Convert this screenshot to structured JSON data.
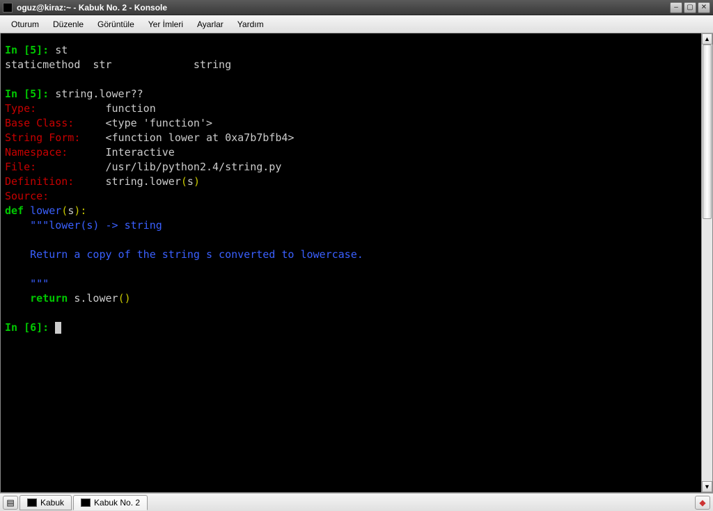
{
  "window": {
    "title": "oguz@kiraz:~ - Kabuk No. 2 - Konsole"
  },
  "menu": {
    "items": [
      "Oturum",
      "Düzenle",
      "Görüntüle",
      "Yer İmleri",
      "Ayarlar",
      "Yardım"
    ]
  },
  "terminal": {
    "line1_prompt": "In [5]: ",
    "line1_cmd": "st",
    "line2": "staticmethod  str             string",
    "line3_prompt": "In [5]: ",
    "line3_cmd": "string.lower??",
    "type_label": "Type:",
    "type_val": "           function",
    "base_label": "Base Class:",
    "base_val": "     <type 'function'>",
    "strform_label": "String Form:",
    "strform_val": "    <function lower at 0xa7b7bfb4>",
    "ns_label": "Namespace:",
    "ns_val": "      Interactive",
    "file_label": "File:",
    "file_val": "           /usr/lib/python2.4/string.py",
    "def_label": "Definition:",
    "def_pre": "     string.lower",
    "def_paren_open": "(",
    "def_arg": "s",
    "def_paren_close": ")",
    "src_label": "Source:",
    "def_kw": "def",
    "def_name": " lower",
    "def_sig_open": "(",
    "def_sig_arg": "s",
    "def_sig_close": "):",
    "doc1": "    \"\"\"lower(s) -> string",
    "doc2": "    Return a copy of the string s converted to lowercase.",
    "doc3": "    \"\"\"",
    "ret_indent": "    ",
    "ret_kw": "return",
    "ret_expr": " s.lower",
    "ret_paren": "()",
    "prompt_final": "In [6]: "
  },
  "tabs": {
    "tab1": "Kabuk",
    "tab2": "Kabuk No. 2"
  }
}
